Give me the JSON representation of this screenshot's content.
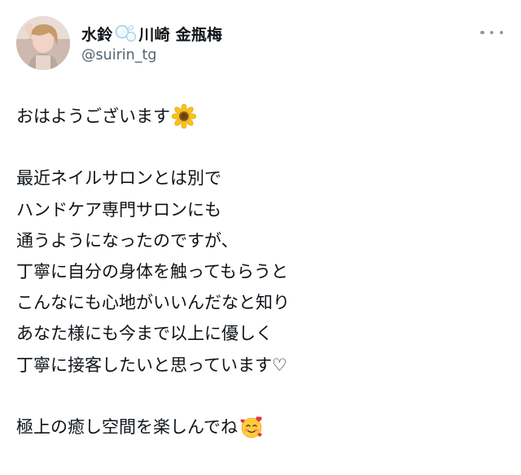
{
  "tweet": {
    "display_name_part1": "水鈴",
    "display_name_part2": "川崎 金瓶梅",
    "handle": "@suirin_tg",
    "more_label": "more-options",
    "lines": [
      "おはようございます",
      "最近ネイルサロンとは別で",
      "ハンドケア専門サロンにも",
      "通うようになったのですが、",
      "丁寧に自分の身体を触ってもらうと",
      "こんなにも心地がいいんだなと知り",
      "あなた様にも今まで以上に優しく",
      "丁寧に接客したいと思っています♡",
      "極上の癒し空間を楽しんでね"
    ],
    "icons": {
      "name_bubble": "bubbles-icon",
      "greeting_emoji": "sunflower-icon",
      "closing_emoji": "smiling-face-with-hearts-icon"
    }
  },
  "colors": {
    "text": "#0f1419",
    "handle": "#536471",
    "more_dots": "#8b98a5"
  }
}
